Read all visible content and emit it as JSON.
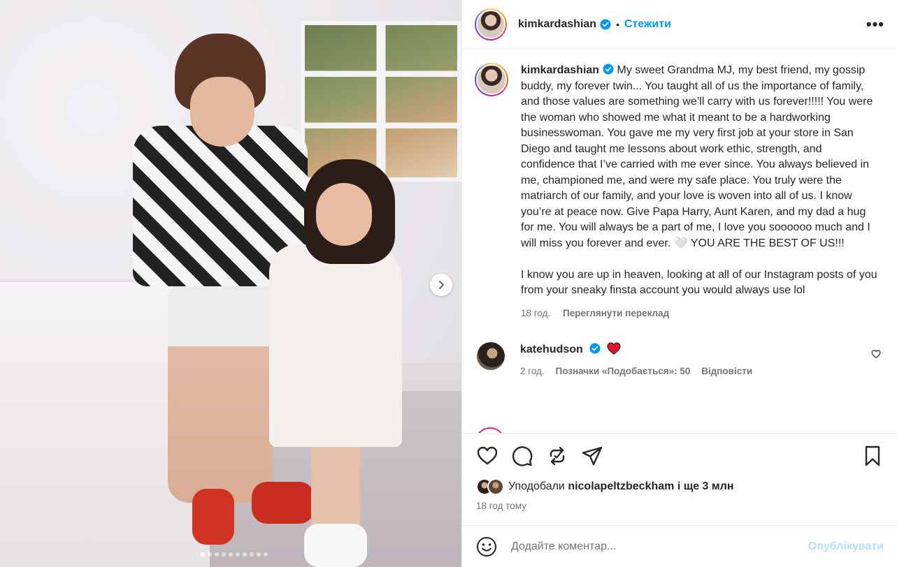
{
  "post": {
    "username": "kimkardashian",
    "follow_label": "Стежити",
    "separator": "•",
    "more_label": "•••"
  },
  "photo": {
    "slide_count": 10,
    "active_slide": 1
  },
  "caption": {
    "username": "kimkardashian",
    "text": "My sweet Grandma MJ, my best friend, my gossip buddy, my forever twin... You taught all of us the importance of family, and those values are something we’ll carry with us forever!!!!! You were the woman who showed me what it meant to be a hardworking businesswoman. You gave me my very first job at your store in San Diego and taught me lessons about work ethic, strength, and confidence that I’ve carried with me ever since. You always believed in me, championed me, and were my safe place. You truly were the matriarch of our family, and your love is woven into all of us. I know you’re at peace now. Give Papa Harry, Aunt Karen, and my dad a hug for me. You will always be a part of me, I love you soooooo much and I will miss you forever and ever. 🤍 YOU ARE THE BEST OF US!!!\n\nI know you are up in heaven, looking at all of our Instagram posts of you from your sneaky finsta account you would always use lol",
    "time": "18 год.",
    "translate_label": "Переглянути переклад"
  },
  "comment": {
    "username": "katehudson",
    "time": "2 год.",
    "likes_label": "Позначки «Подобається»: 50",
    "reply_label": "Відповісти"
  },
  "likes": {
    "prefix": "Уподобали",
    "user": "nicolapeltzbeckham",
    "suffix": "і ще 3 млн"
  },
  "posted_ago": "18 год тому",
  "add_comment": {
    "placeholder": "Додайте коментар...",
    "publish_label": "Опублікувати"
  },
  "colors": {
    "accent": "#0095f6",
    "publish_disabled": "#b2dffc",
    "muted": "#737373",
    "heart": "#ed4956"
  },
  "icons": [
    "chevron-right-icon",
    "verified-icon",
    "more-icon",
    "heart-icon",
    "comment-icon",
    "repost-icon",
    "share-icon",
    "bookmark-icon",
    "emoji-icon",
    "red-heart-icon"
  ]
}
